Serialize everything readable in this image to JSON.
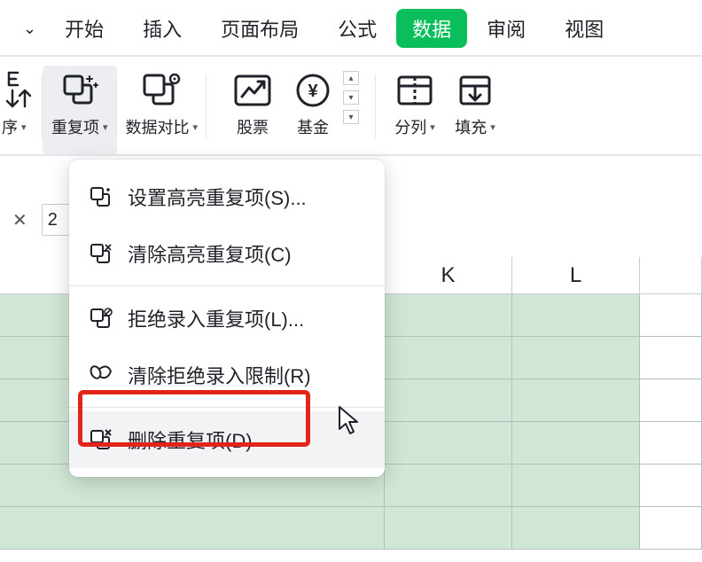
{
  "tabs": {
    "items": [
      "开始",
      "插入",
      "页面布局",
      "公式",
      "数据",
      "审阅",
      "视图"
    ],
    "active_index": 4
  },
  "ribbon": {
    "sort_label": "序",
    "duplicates_label": "重复项",
    "data_compare_label": "数据对比",
    "stocks_label": "股票",
    "funds_label": "基金",
    "split_label": "分列",
    "fill_label": "填充"
  },
  "dropdown": {
    "items": [
      {
        "icon": "sparkle",
        "label": "设置高亮重复项(S)..."
      },
      {
        "icon": "clear-sparkle",
        "label": "清除高亮重复项(C)"
      },
      {
        "icon": "reject",
        "label": "拒绝录入重复项(L)..."
      },
      {
        "icon": "erase",
        "label": "清除拒绝录入限制(R)"
      },
      {
        "icon": "remove",
        "label": "删除重复项(D)"
      }
    ]
  },
  "formula": {
    "value_partial": "2"
  },
  "grid": {
    "visible_columns": [
      "K",
      "L"
    ]
  }
}
